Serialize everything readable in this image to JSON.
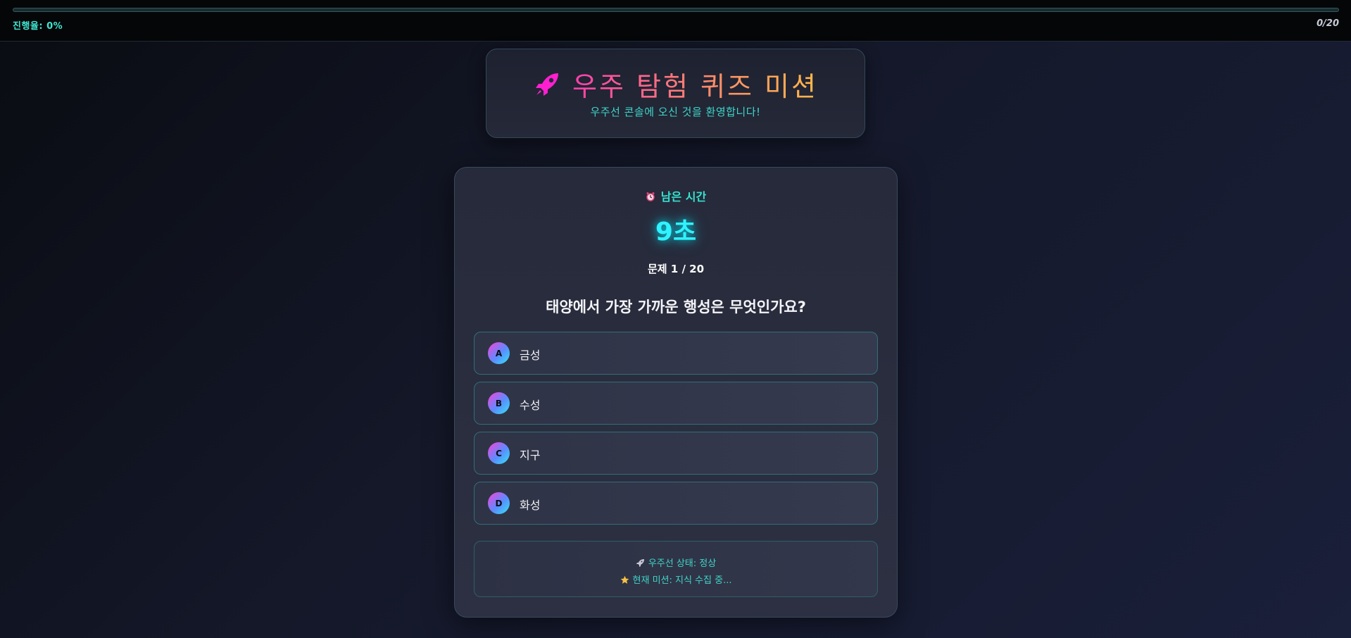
{
  "progress": {
    "label": "진행율: 0%",
    "count": "0/20",
    "fraction": 0
  },
  "header": {
    "title": "우주 탐험 퀴즈 미션",
    "subtitle": "우주선 콘솔에 오신 것을 환영합니다!",
    "icon": "rocket-icon"
  },
  "timer": {
    "label": "남은 시간",
    "value": "9초",
    "icon": "alarm-clock-icon"
  },
  "question": {
    "number": "문제 1 / 20",
    "text": "태양에서 가장 가까운 행성은 무엇인가요?"
  },
  "options": [
    {
      "letter": "A",
      "text": "금성"
    },
    {
      "letter": "B",
      "text": "수성"
    },
    {
      "letter": "C",
      "text": "지구"
    },
    {
      "letter": "D",
      "text": "화성"
    }
  ],
  "status": {
    "ship": "우주선 상태: 정상",
    "mission": "현재 미션: 지식 수집 중...",
    "ship_icon": "rocket-icon",
    "mission_icon": "star-icon"
  },
  "colors": {
    "accent_cyan": "#2ff3ff",
    "accent_teal": "#3fd6c8",
    "accent_pink": "#ff3fd8",
    "title_gradient_end": "#ffb84a"
  }
}
